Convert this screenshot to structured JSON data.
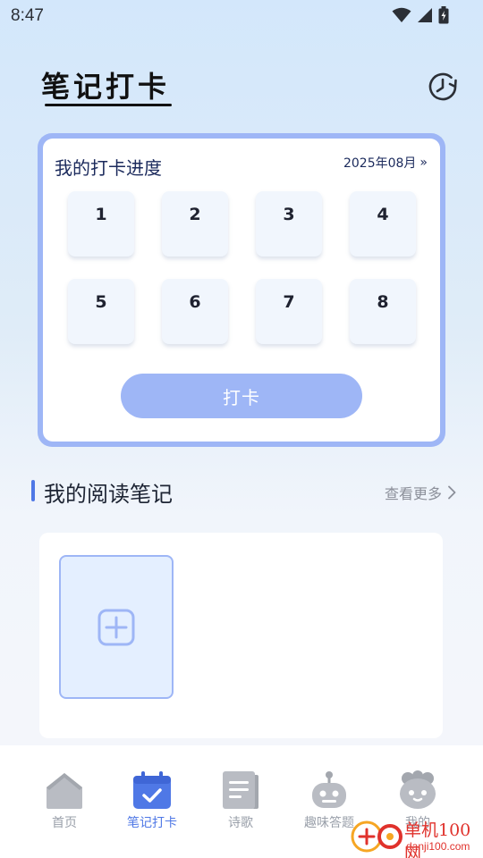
{
  "status_bar": {
    "time": "8:47",
    "icons": [
      "wifi-icon",
      "signal-icon",
      "battery-icon"
    ]
  },
  "header": {
    "title": "笔记打卡",
    "history_icon": "clock-history-icon"
  },
  "progress": {
    "title": "我的打卡进度",
    "month": "2025年08月",
    "month_chevron": "»",
    "days": [
      "1",
      "2",
      "3",
      "4",
      "5",
      "6",
      "7",
      "8"
    ],
    "checkin_label": "打卡"
  },
  "notes": {
    "title": "我的阅读笔记",
    "more_label": "查看更多",
    "add_icon": "add-square-icon"
  },
  "nav": {
    "items": [
      {
        "label": "首页",
        "icon": "home-icon"
      },
      {
        "label": "笔记打卡",
        "icon": "calendar-check-icon"
      },
      {
        "label": "诗歌",
        "icon": "document-icon"
      },
      {
        "label": "趣味答题",
        "icon": "robot-icon"
      },
      {
        "label": "我的",
        "icon": "profile-icon"
      }
    ],
    "active_index": 1
  },
  "watermark": {
    "site": "单机100网",
    "url": "danji100.com"
  },
  "colors": {
    "accent": "#4f78e6",
    "card_border": "#9eb6f6",
    "nav_inactive": "#9aa0aa"
  }
}
